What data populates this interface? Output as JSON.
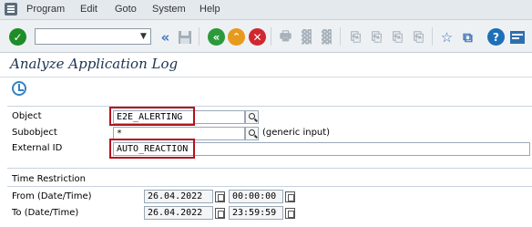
{
  "menu": {
    "items": [
      "Program",
      "Edit",
      "Goto",
      "System",
      "Help"
    ]
  },
  "toolbar": {
    "command_field_value": ""
  },
  "page": {
    "title": "Analyze Application Log"
  },
  "selection": {
    "object": {
      "label": "Object",
      "value": "E2E_ALERTING"
    },
    "subobject": {
      "label": "Subobject",
      "value": "*",
      "hint": "(generic input)"
    },
    "external_id": {
      "label": "External ID",
      "value": "AUTO_REACTION"
    }
  },
  "time_restriction": {
    "title": "Time Restriction",
    "from": {
      "label": "From (Date/Time)",
      "date": "26.04.2022",
      "time": "00:00:00"
    },
    "to": {
      "label": "To (Date/Time)",
      "date": "26.04.2022",
      "time": "23:59:59"
    }
  },
  "colors": {
    "highlight": "#b3121c",
    "ok_green": "#1e8d28",
    "nav_blue": "#3b73b7"
  }
}
